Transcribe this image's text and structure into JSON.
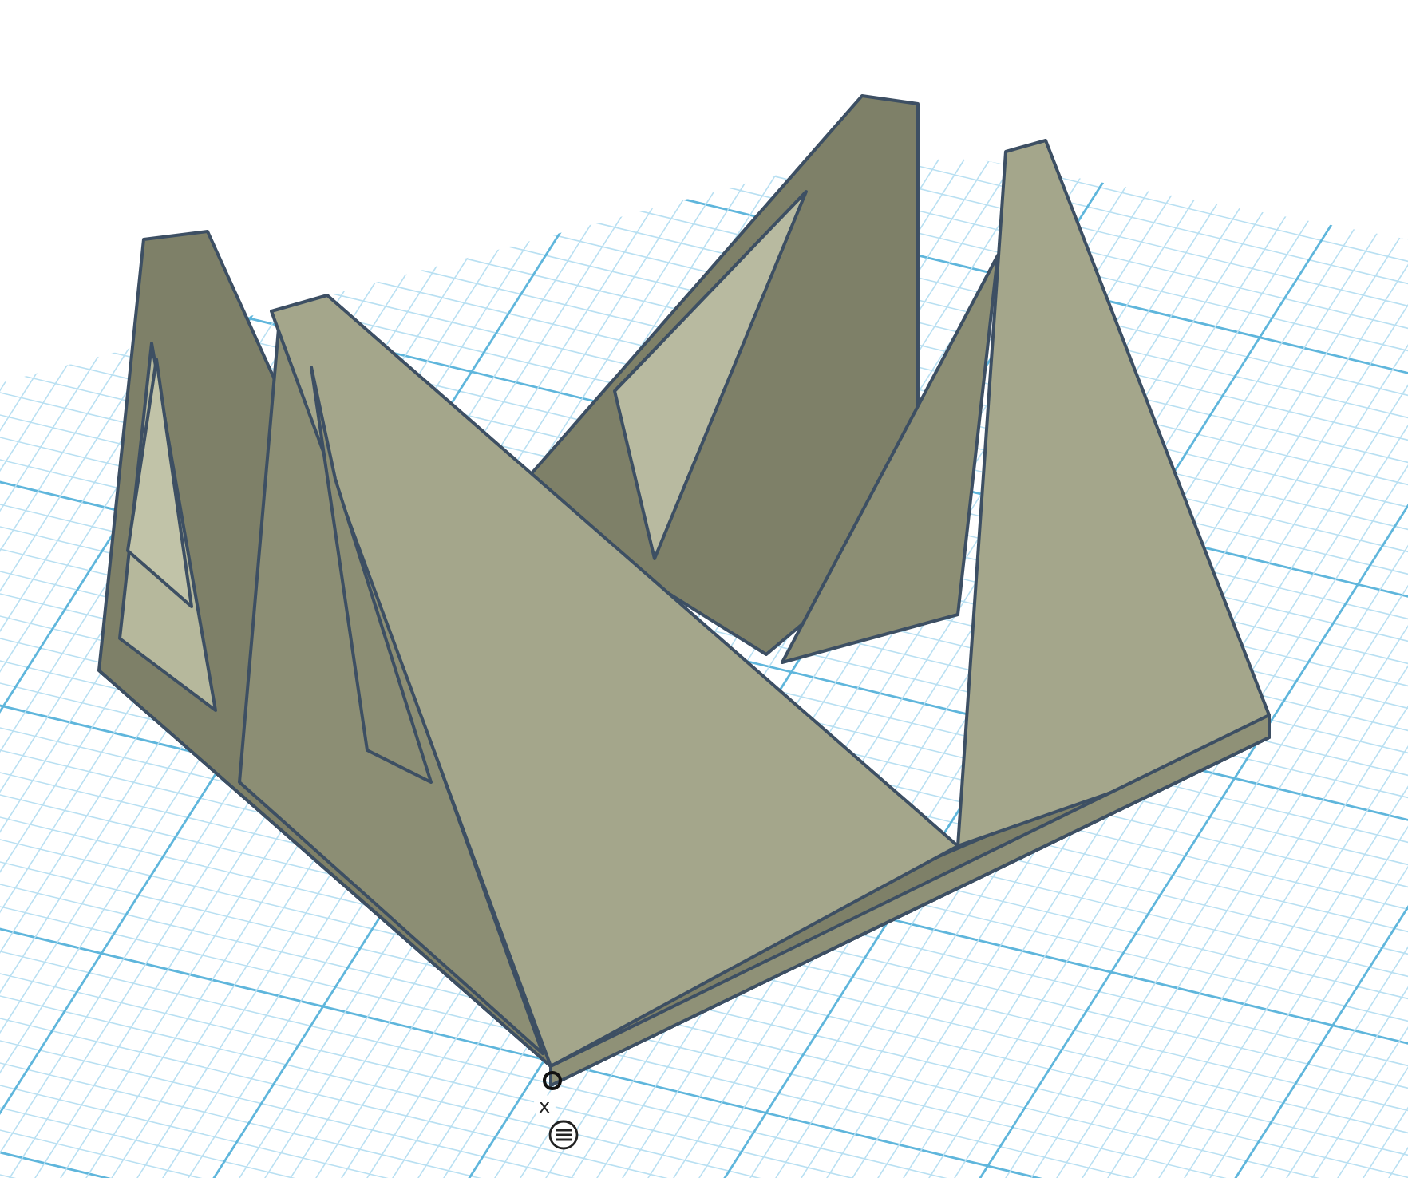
{
  "viewport": {
    "axis_label": "x"
  }
}
